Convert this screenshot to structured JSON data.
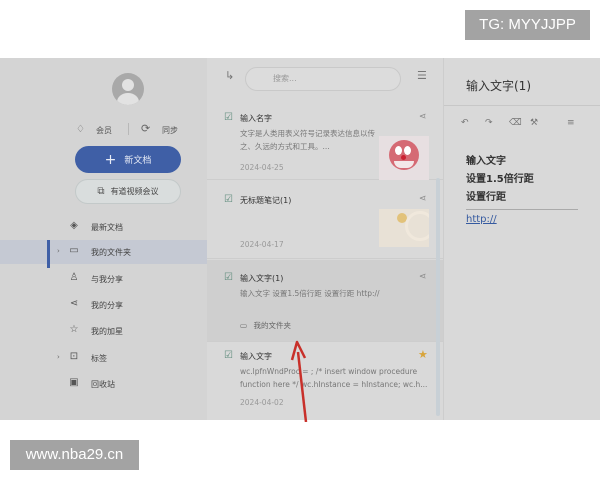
{
  "watermarks": {
    "top_right": "TG: MYYJJPP",
    "bottom_left": "www.nba29.cn"
  },
  "sidebar": {
    "vip_label": "会员",
    "sync_label": "同步",
    "new_doc_label": "新文档",
    "meeting_label": "有道视频会议",
    "items": [
      {
        "label": "最新文档",
        "icon": "clock-stack-icon"
      },
      {
        "label": "我的文件夹",
        "icon": "folder-icon",
        "active": true,
        "expandable": true
      },
      {
        "label": "与我分享",
        "icon": "users-icon"
      },
      {
        "label": "我的分享",
        "icon": "share-icon"
      },
      {
        "label": "我的加星",
        "icon": "star-icon"
      },
      {
        "label": "标签",
        "icon": "tag-icon",
        "expandable": true
      },
      {
        "label": "回收站",
        "icon": "trash-icon"
      }
    ]
  },
  "list": {
    "search_placeholder": "搜索...",
    "cards": [
      {
        "title": "输入名字",
        "snippet": "文字是人类用表义符号记录表达信息以传之、久远的方式和工具。...",
        "date": "2024-04-25",
        "thumbnail": "doraemon"
      },
      {
        "title": "无标题笔记(1)",
        "date": "2024-04-17",
        "thumbnail": "sketch"
      },
      {
        "title": "输入文字(1)",
        "snippet": "输入文字 设置1.5倍行距 设置行距 http://",
        "folder": "我的文件夹"
      },
      {
        "title": "输入文字",
        "snippet": "wc.lpfnWndProc = ; /* insert window procedure function here */ wc.hInstance = hInstance; wc.h...",
        "date": "2024-04-02",
        "starred": true
      }
    ]
  },
  "editor": {
    "title": "输入文字(1)",
    "lines": [
      "输入文字",
      "设置1.5倍行距",
      "设置行距"
    ],
    "link": "http://"
  },
  "colors": {
    "accent": "#3f5fa6",
    "annotation": "#c8302a",
    "star": "#d8a43a"
  }
}
